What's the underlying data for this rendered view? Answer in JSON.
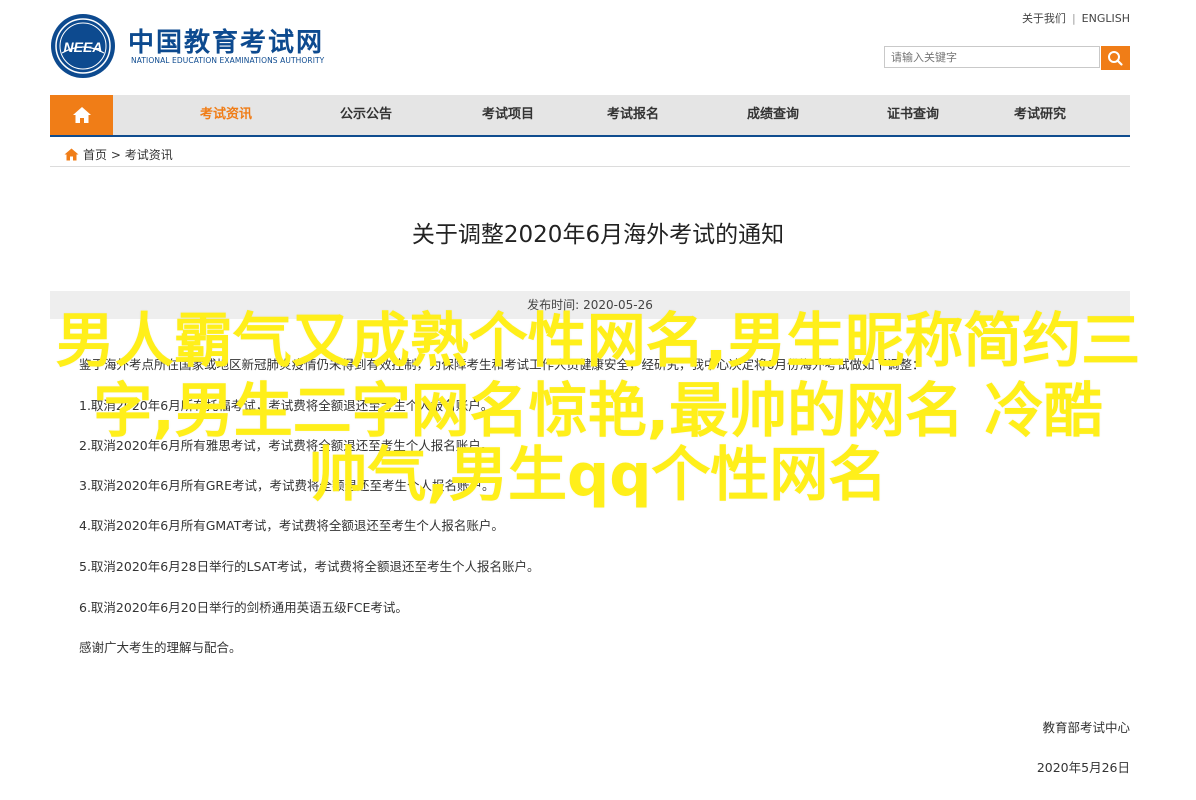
{
  "header": {
    "title": "中国教育考试网",
    "subtitle": "NATIONAL EDUCATION EXAMINATIONS AUTHORITY",
    "logo_text": "NEEA",
    "toplinks": [
      "关于我们",
      "ENGLISH"
    ],
    "search_placeholder": "请输入关键字"
  },
  "nav": {
    "items": [
      "考试资讯",
      "公示公告",
      "考试项目",
      "考试报名",
      "成绩查询",
      "证书查询",
      "考试研究"
    ],
    "active": "考试资讯"
  },
  "breadcrumb": {
    "items": [
      "首页",
      "考试资讯"
    ],
    "separator": ">"
  },
  "article": {
    "title": "关于调整2020年6月海外考试的通知",
    "publish_label": "发布时间:",
    "publish_date": "2020-05-26",
    "paragraphs": [
      "鉴于海外考点所在国家或地区新冠肺炎疫情仍未得到有效控制，为保障考生和考试工作人员健康安全，经研究，我中心决定将6月份海外考试做如下调整：",
      "1.取消2020年6月所有托福考试，考试费将全额退还至考生个人报名账户。",
      "2.取消2020年6月所有雅思考试，考试费将全额退还至考生个人报名账户。",
      "3.取消2020年6月所有GRE考试，考试费将全额退还至考生个人报名账户。",
      "4.取消2020年6月所有GMAT考试，考试费将全额退还至考生个人报名账户。",
      "5.取消2020年6月28日举行的LSAT考试，考试费将全额退还至考生个人报名账户。",
      "6.取消2020年6月20日举行的剑桥通用英语五级FCE考试。",
      "感谢广大考生的理解与配合。"
    ],
    "signature_org": "教育部考试中心",
    "signature_date": "2020年5月26日"
  },
  "overlay": {
    "lines": [
      "男人霸气又成熟个性网名,男生昵称简约三",
      "字,男生二字网名惊艳,最帅的网名 冷酷",
      "帅气,男生qq个性网名"
    ],
    "color": "#ffef1a"
  },
  "colors": {
    "brand_blue": "#0d4a8f",
    "accent_orange": "#f07d17",
    "nav_bg": "#e5e5e5"
  },
  "icons": [
    "neea-logo",
    "search-icon",
    "home-icon",
    "breadcrumb-home-icon"
  ]
}
